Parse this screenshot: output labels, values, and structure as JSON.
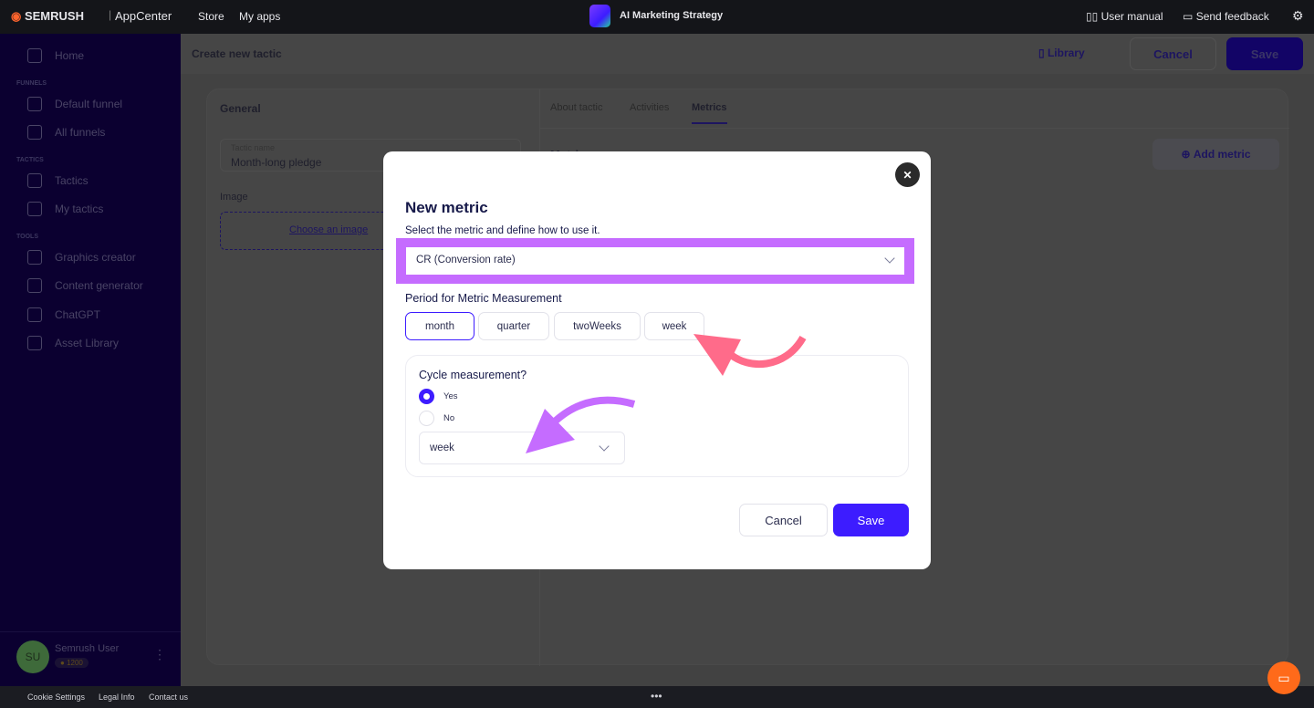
{
  "topbar": {
    "brand": "SEMRUSH",
    "product": "AppCenter",
    "nav": [
      "Store",
      "My apps"
    ],
    "app_title": "AI Marketing Strategy",
    "user_manual": "User manual",
    "send_feedback": "Send feedback"
  },
  "sidebar": {
    "home": "Home",
    "funnels_label": "FUNNELS",
    "default_funnel": "Default funnel",
    "all_funnels": "All funnels",
    "tactics_label": "TACTICS",
    "tactics": "Tactics",
    "my_tactics": "My tactics",
    "tools_label": "TOOLS",
    "graphics_creator": "Graphics creator",
    "content_generator": "Content generator",
    "chatgpt": "ChatGPT",
    "asset_library": "Asset Library",
    "user": {
      "initials": "SU",
      "name": "Semrush User",
      "credits": "1200"
    }
  },
  "header": {
    "title": "Create new tactic",
    "library": "Library",
    "cancel": "Cancel",
    "save": "Save"
  },
  "general": {
    "title": "General",
    "tactic_name_label": "Tactic name",
    "tactic_name_value": "Month-long pledge",
    "image_label": "Image",
    "choose_image": "Choose an image"
  },
  "tabs": [
    "About tactic",
    "Activities",
    "Metrics"
  ],
  "metrics": {
    "heading": "Metri",
    "add_metric": "Add metric"
  },
  "modal": {
    "title": "New metric",
    "subtitle": "Select the metric and define how to use it.",
    "metric_value": "CR (Conversion rate)",
    "period_label": "Period for Metric Measurement",
    "periods": [
      "month",
      "quarter",
      "twoWeeks",
      "week"
    ],
    "selected_period": "month",
    "cycle_label": "Cycle measurement?",
    "yes": "Yes",
    "no": "No",
    "cycle_selected": "Yes",
    "cycle_period": "week",
    "cancel": "Cancel",
    "save": "Save"
  },
  "footer": {
    "cookie": "Cookie Settings",
    "legal": "Legal Info",
    "contact": "Contact us"
  },
  "colors": {
    "accent": "#3d1cff",
    "highlight": "#c56cff",
    "arrow_pink": "#ff6b8a",
    "chat": "#ff6a1a"
  }
}
